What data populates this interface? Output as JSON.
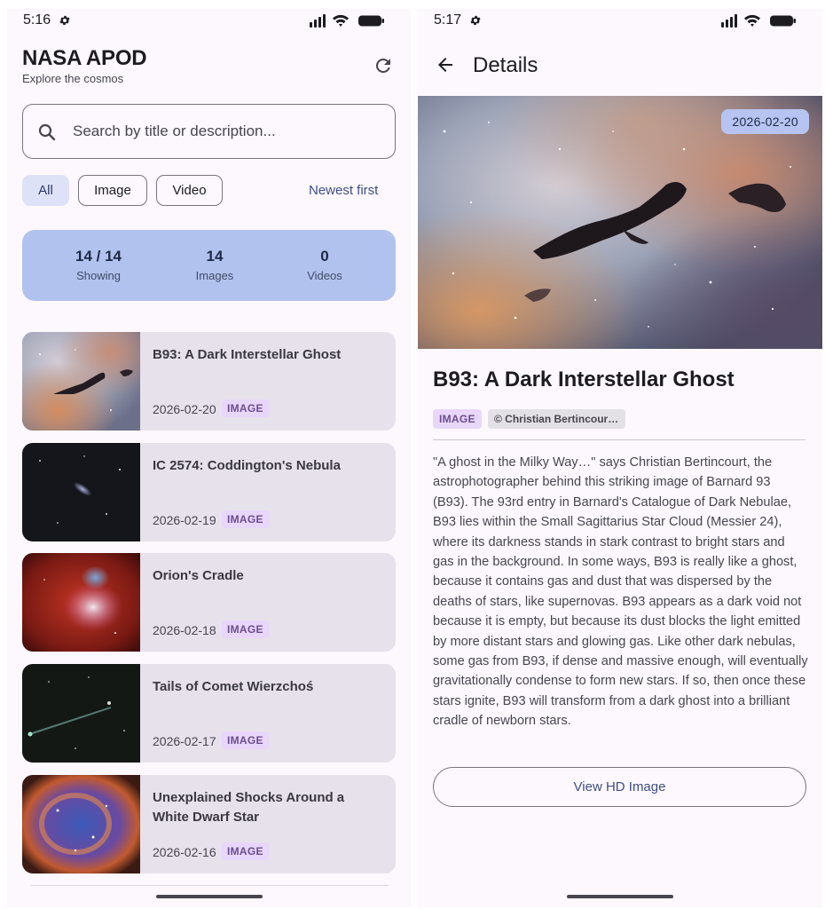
{
  "left": {
    "status": {
      "time": "5:16"
    },
    "app": {
      "title": "NASA APOD",
      "subtitle": "Explore the cosmos"
    },
    "search": {
      "placeholder": "Search by title or description..."
    },
    "filters": {
      "all": "All",
      "image": "Image",
      "video": "Video",
      "sort": "Newest first",
      "selected": "All"
    },
    "stats": [
      {
        "value": "14 / 14",
        "label": "Showing"
      },
      {
        "value": "14",
        "label": "Images"
      },
      {
        "value": "0",
        "label": "Videos"
      }
    ],
    "items": [
      {
        "title": "B93: A Dark Interstellar Ghost",
        "date": "2026-02-20",
        "type": "IMAGE"
      },
      {
        "title": "IC 2574: Coddington's Nebula",
        "date": "2026-02-19",
        "type": "IMAGE"
      },
      {
        "title": "Orion's Cradle",
        "date": "2026-02-18",
        "type": "IMAGE"
      },
      {
        "title": "Tails of Comet Wierzchoś",
        "date": "2026-02-17",
        "type": "IMAGE"
      },
      {
        "title": "Unexplained Shocks Around a White Dwarf Star",
        "date": "2026-02-16",
        "type": "IMAGE"
      }
    ]
  },
  "right": {
    "status": {
      "time": "5:17"
    },
    "header": {
      "title": "Details"
    },
    "detail": {
      "date": "2026-02-20",
      "title": "B93: A Dark Interstellar Ghost",
      "type": "IMAGE",
      "credit": "© Christian Bertincour…",
      "description": "\"A ghost in the Milky Way…\" says Christian Bertincourt, the astrophotographer behind this striking image of Barnard 93 (B93).  The 93rd entry in Barnard's Catalogue of Dark Nebulae, B93 lies within the Small Sagittarius Star Cloud (Messier 24), where its darkness stands in stark contrast to bright stars and gas in the background.  In some ways, B93 is really like a ghost, because it contains gas and dust that was dispersed by the deaths of stars, like supernovas.  B93 appears as a dark void not because it is empty, but because its dust blocks the light emitted by more distant stars and glowing gas.  Like other dark nebulas, some gas from B93, if dense and massive enough, will eventually gravitationally condense to form new stars.  If so, then once these stars ignite, B93 will transform from a dark ghost into a brilliant cradle of newborn stars.",
      "hd_button": "View HD Image"
    }
  },
  "colors": {
    "background": "#fcf8fe",
    "accent_text": "#3f4d86",
    "stats_card": "#b2c2ee",
    "chip_selected": "#dde2f7",
    "badge": "#e9d6fb",
    "list_item": "#e6e1ea"
  },
  "icons": [
    "settings-gear-icon",
    "signal-icon",
    "wifi-icon",
    "battery-icon",
    "refresh-icon",
    "search-icon",
    "back-arrow-icon"
  ]
}
